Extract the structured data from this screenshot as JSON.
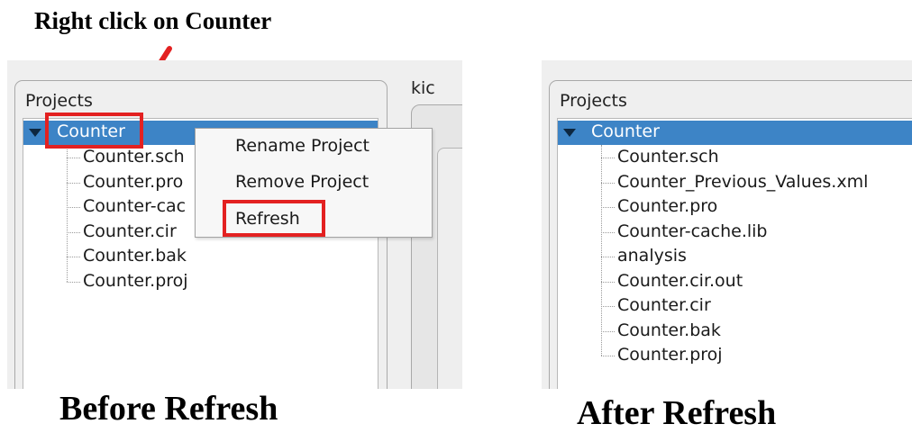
{
  "annotations": {
    "hint": "Right click on Counter",
    "before_caption": "Before Refresh",
    "after_caption": "After Refresh",
    "highlight_color": "#e32121"
  },
  "before": {
    "group_title": "Projects",
    "root": "Counter",
    "files": [
      "Counter.sch",
      "Counter.pro",
      "Counter-cac",
      "Counter.cir",
      "Counter.bak",
      "Counter.proj"
    ],
    "side_tab_label": "kic",
    "context_menu": {
      "rename": "Rename Project",
      "remove": "Remove Project",
      "refresh": "Refresh"
    }
  },
  "after": {
    "group_title": "Projects",
    "root": "Counter",
    "files": [
      "Counter.sch",
      "Counter_Previous_Values.xml",
      "Counter.pro",
      "Counter-cache.lib",
      "analysis",
      "Counter.cir.out",
      "Counter.cir",
      "Counter.bak",
      "Counter.proj"
    ]
  },
  "colors": {
    "selection": "#3d84c6",
    "panel": "#efefef",
    "tree_background": "#ffffff"
  }
}
